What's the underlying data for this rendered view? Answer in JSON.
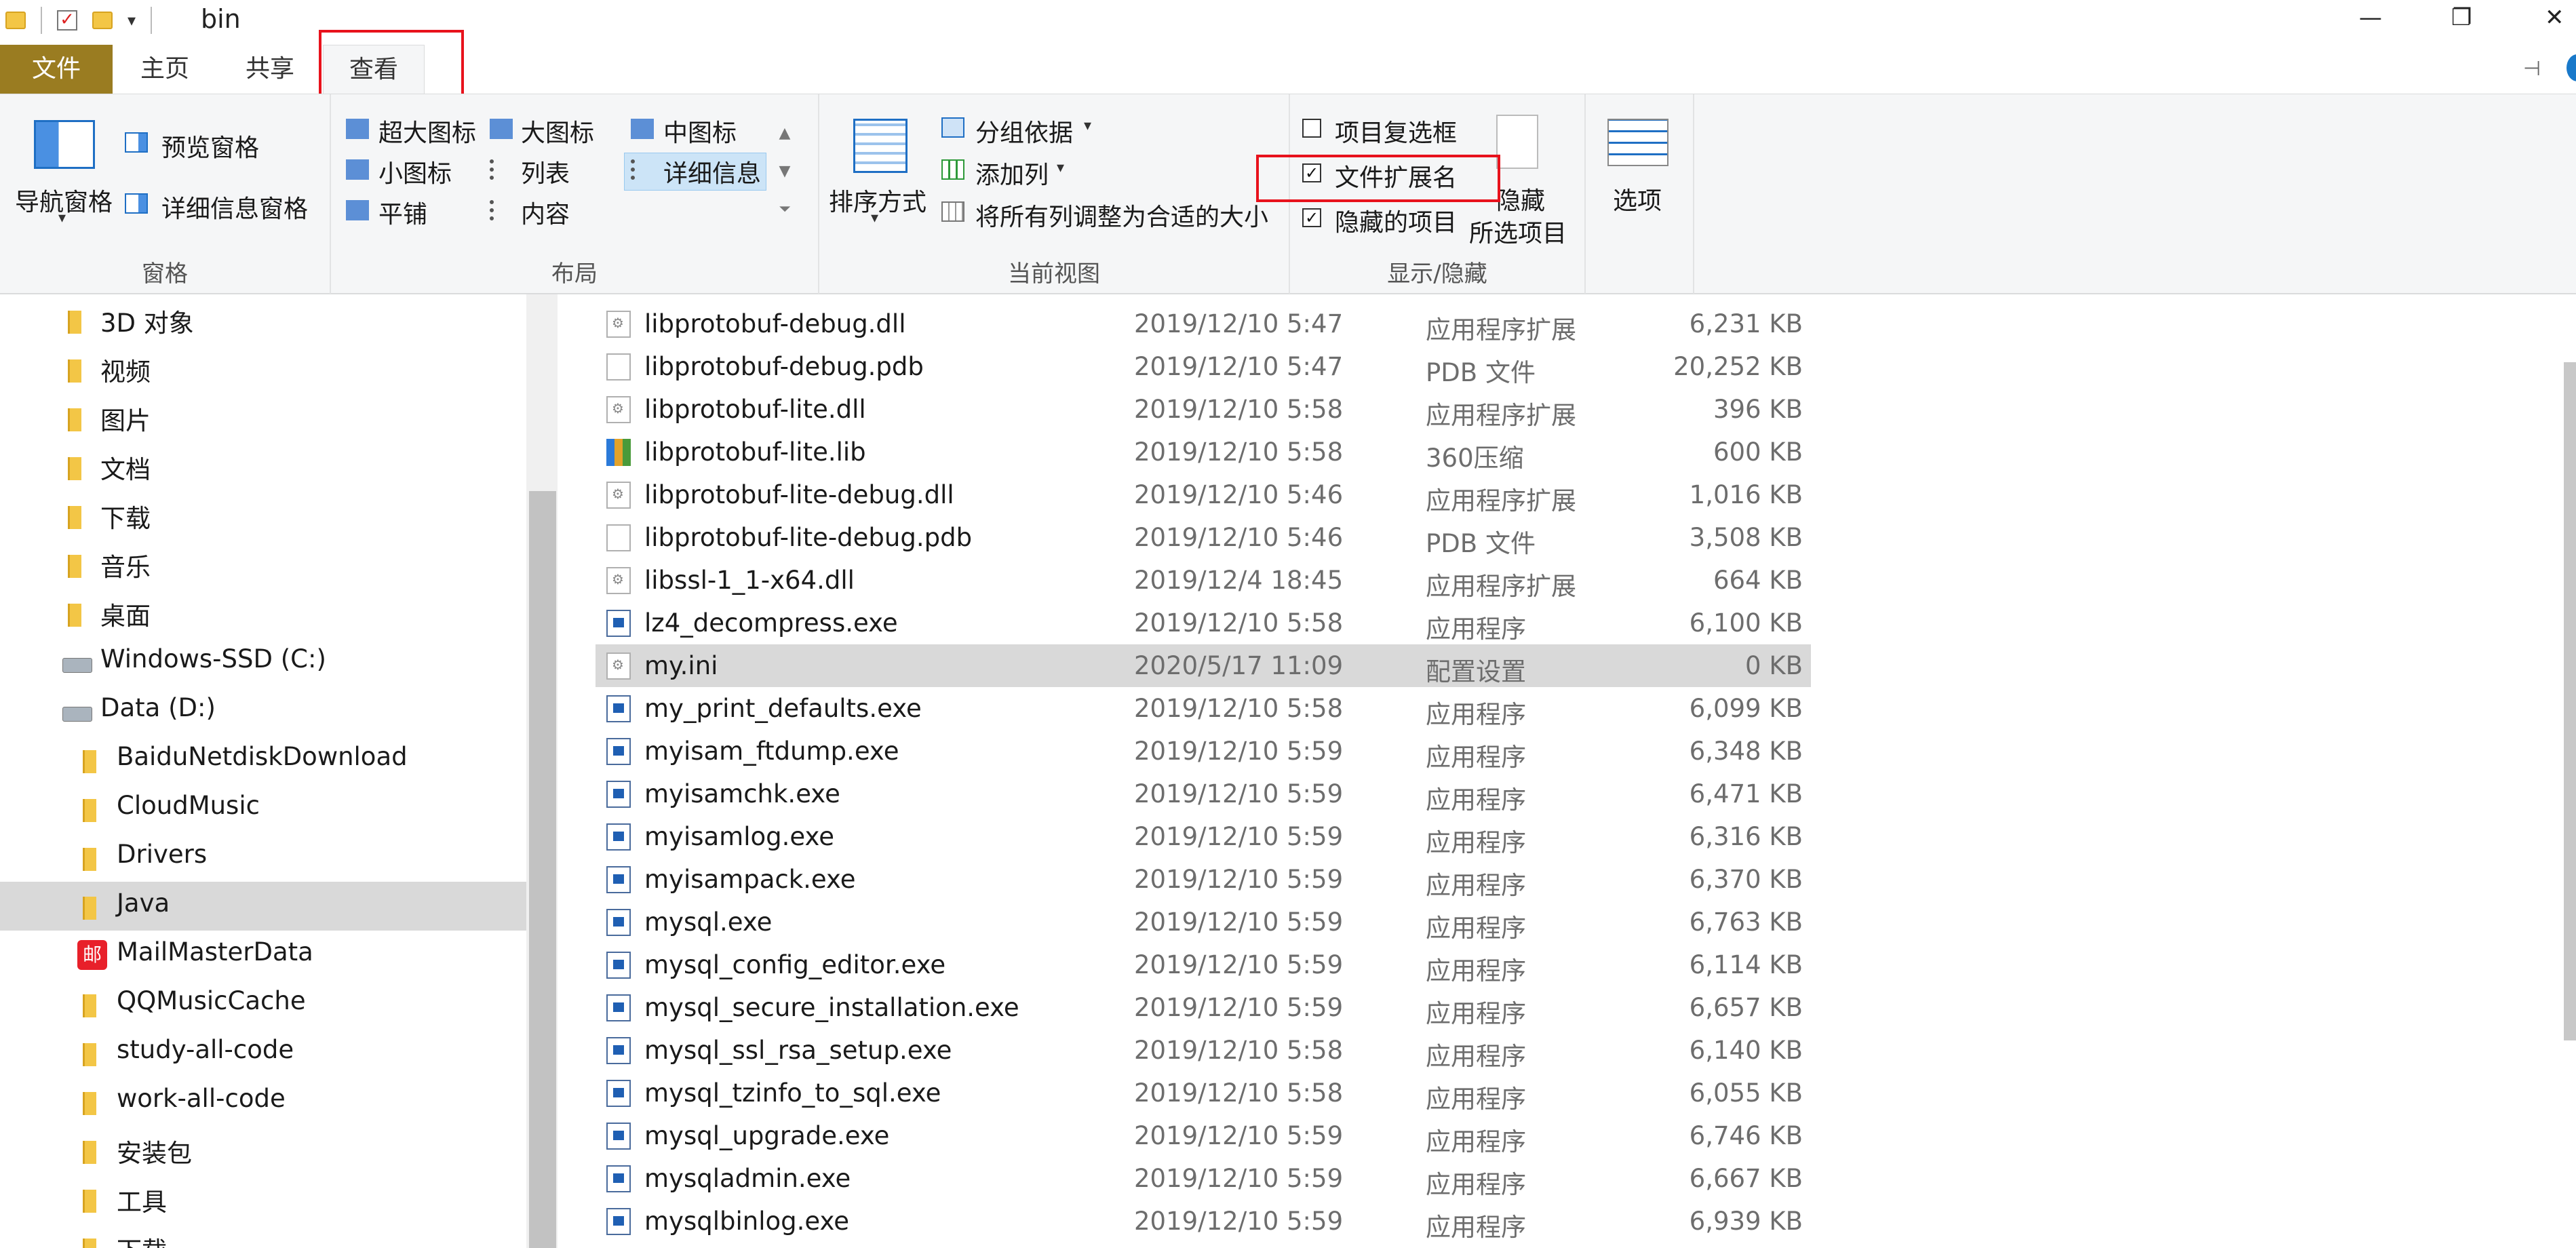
{
  "window": {
    "title": "bin"
  },
  "tabs": [
    "文件",
    "主页",
    "共享",
    "查看"
  ],
  "ribbon": {
    "pane_group": {
      "nav_pane": "导航窗格",
      "preview_pane": "预览窗格",
      "details_pane": "详细信息窗格",
      "label": "窗格"
    },
    "layout_group": {
      "options": [
        "超大图标",
        "大图标",
        "中图标",
        "小图标",
        "列表",
        "详细信息",
        "平铺",
        "内容"
      ],
      "selected": "详细信息",
      "label": "布局"
    },
    "current_view_group": {
      "sort": "排序方式",
      "group_by": "分组依据",
      "add_columns": "添加列",
      "fit_columns": "将所有列调整为合适的大小",
      "label": "当前视图"
    },
    "show_hide_group": {
      "item_checkboxes": {
        "label": "项目复选框",
        "checked": false
      },
      "file_extensions": {
        "label": "文件扩展名",
        "checked": true
      },
      "hidden_items": {
        "label": "隐藏的项目",
        "checked": true
      },
      "hide_selected_line1": "隐藏",
      "hide_selected_line2": "所选项目",
      "label": "显示/隐藏"
    },
    "options": "选项"
  },
  "nav": {
    "items": [
      {
        "label": "3D 对象"
      },
      {
        "label": "视频"
      },
      {
        "label": "图片"
      },
      {
        "label": "文档"
      },
      {
        "label": "下载"
      },
      {
        "label": "音乐"
      },
      {
        "label": "桌面"
      },
      {
        "label": "Windows-SSD (C:)"
      },
      {
        "label": "Data (D:)"
      },
      {
        "label": "BaiduNetdiskDownload"
      },
      {
        "label": "CloudMusic"
      },
      {
        "label": "Drivers"
      },
      {
        "label": "Java"
      },
      {
        "label": "MailMasterData"
      },
      {
        "label": "QQMusicCache"
      },
      {
        "label": "study-all-code"
      },
      {
        "label": "work-all-code"
      },
      {
        "label": "安装包"
      },
      {
        "label": "工具"
      },
      {
        "label": "下载"
      }
    ],
    "selected": "Java",
    "mail_icon_glyph": "邮"
  },
  "files": [
    {
      "name": "libprotobuf-debug.dll",
      "date": "2019/12/10 5:47",
      "type": "应用程序扩展",
      "size": "6,231 KB",
      "icon": "dll-icon"
    },
    {
      "name": "libprotobuf-debug.pdb",
      "date": "2019/12/10 5:47",
      "type": "PDB 文件",
      "size": "20,252 KB",
      "icon": "file-icon"
    },
    {
      "name": "libprotobuf-lite.dll",
      "date": "2019/12/10 5:58",
      "type": "应用程序扩展",
      "size": "396 KB",
      "icon": "dll-icon"
    },
    {
      "name": "libprotobuf-lite.lib",
      "date": "2019/12/10 5:58",
      "type": "360压缩",
      "size": "600 KB",
      "icon": "archive-icon"
    },
    {
      "name": "libprotobuf-lite-debug.dll",
      "date": "2019/12/10 5:46",
      "type": "应用程序扩展",
      "size": "1,016 KB",
      "icon": "dll-icon"
    },
    {
      "name": "libprotobuf-lite-debug.pdb",
      "date": "2019/12/10 5:46",
      "type": "PDB 文件",
      "size": "3,508 KB",
      "icon": "file-icon"
    },
    {
      "name": "libssl-1_1-x64.dll",
      "date": "2019/12/4 18:45",
      "type": "应用程序扩展",
      "size": "664 KB",
      "icon": "dll-icon"
    },
    {
      "name": "lz4_decompress.exe",
      "date": "2019/12/10 5:58",
      "type": "应用程序",
      "size": "6,100 KB",
      "icon": "exe-icon"
    },
    {
      "name": "my.ini",
      "date": "2020/5/17 11:09",
      "type": "配置设置",
      "size": "0 KB",
      "icon": "ini-icon"
    },
    {
      "name": "my_print_defaults.exe",
      "date": "2019/12/10 5:58",
      "type": "应用程序",
      "size": "6,099 KB",
      "icon": "exe-icon"
    },
    {
      "name": "myisam_ftdump.exe",
      "date": "2019/12/10 5:59",
      "type": "应用程序",
      "size": "6,348 KB",
      "icon": "exe-icon"
    },
    {
      "name": "myisamchk.exe",
      "date": "2019/12/10 5:59",
      "type": "应用程序",
      "size": "6,471 KB",
      "icon": "exe-icon"
    },
    {
      "name": "myisamlog.exe",
      "date": "2019/12/10 5:59",
      "type": "应用程序",
      "size": "6,316 KB",
      "icon": "exe-icon"
    },
    {
      "name": "myisampack.exe",
      "date": "2019/12/10 5:59",
      "type": "应用程序",
      "size": "6,370 KB",
      "icon": "exe-icon"
    },
    {
      "name": "mysql.exe",
      "date": "2019/12/10 5:59",
      "type": "应用程序",
      "size": "6,763 KB",
      "icon": "exe-icon"
    },
    {
      "name": "mysql_config_editor.exe",
      "date": "2019/12/10 5:59",
      "type": "应用程序",
      "size": "6,114 KB",
      "icon": "exe-icon"
    },
    {
      "name": "mysql_secure_installation.exe",
      "date": "2019/12/10 5:59",
      "type": "应用程序",
      "size": "6,657 KB",
      "icon": "exe-icon"
    },
    {
      "name": "mysql_ssl_rsa_setup.exe",
      "date": "2019/12/10 5:58",
      "type": "应用程序",
      "size": "6,140 KB",
      "icon": "exe-icon"
    },
    {
      "name": "mysql_tzinfo_to_sql.exe",
      "date": "2019/12/10 5:58",
      "type": "应用程序",
      "size": "6,055 KB",
      "icon": "exe-icon"
    },
    {
      "name": "mysql_upgrade.exe",
      "date": "2019/12/10 5:59",
      "type": "应用程序",
      "size": "6,746 KB",
      "icon": "exe-icon"
    },
    {
      "name": "mysqladmin.exe",
      "date": "2019/12/10 5:59",
      "type": "应用程序",
      "size": "6,667 KB",
      "icon": "exe-icon"
    },
    {
      "name": "mysqlbinlog.exe",
      "date": "2019/12/10 5:59",
      "type": "应用程序",
      "size": "6,939 KB",
      "icon": "exe-icon"
    }
  ],
  "selected_file": "my.ini",
  "colors": {
    "file_tab": "#9a7c21",
    "highlight_box": "#e8121c",
    "selection": "#d9d9d9"
  }
}
